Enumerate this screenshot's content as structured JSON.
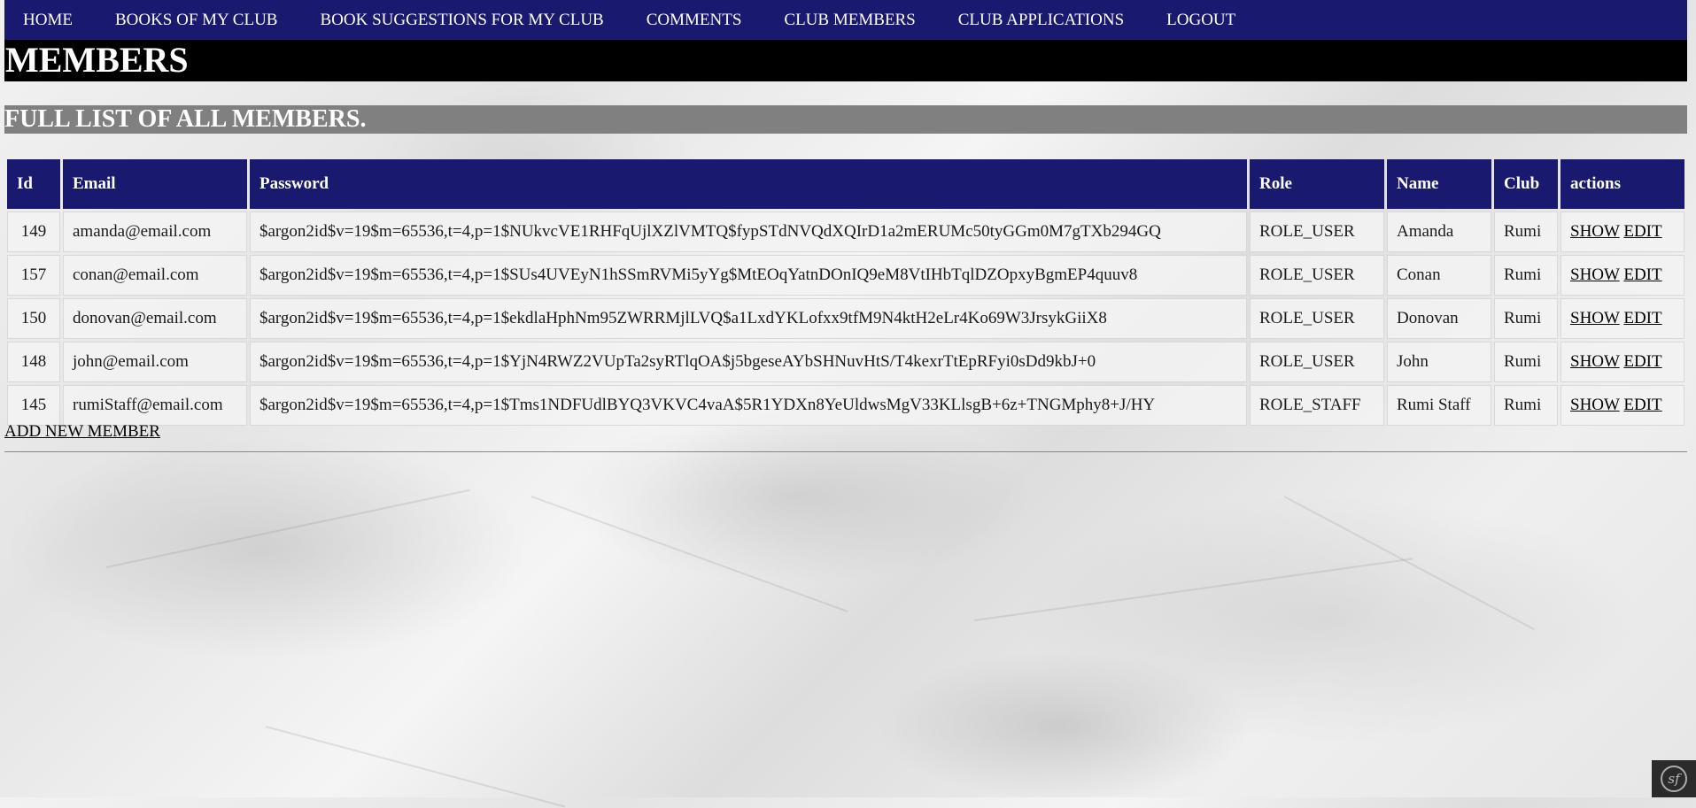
{
  "nav": {
    "items": [
      "HOME",
      "BOOKS OF MY CLUB",
      "BOOK SUGGESTIONS FOR MY CLUB",
      "COMMENTS",
      "CLUB MEMBERS",
      "CLUB APPLICATIONS",
      "LOGOUT"
    ]
  },
  "page": {
    "title": "MEMBERS",
    "subtitle": "FULL LIST OF ALL MEMBERS."
  },
  "table": {
    "headers": [
      "Id",
      "Email",
      "Password",
      "Role",
      "Name",
      "Club",
      "actions"
    ],
    "show_label": "SHOW",
    "edit_label": "EDIT",
    "rows": [
      {
        "id": "149",
        "email": "amanda@email.com",
        "password": "$argon2id$v=19$m=65536,t=4,p=1$NUkvcVE1RHFqUjlXZlVMTQ$fypSTdNVQdXQIrD1a2mERUMc50tyGGm0M7gTXb294GQ",
        "role": "ROLE_USER",
        "name": "Amanda",
        "club": "Rumi"
      },
      {
        "id": "157",
        "email": "conan@email.com",
        "password": "$argon2id$v=19$m=65536,t=4,p=1$SUs4UVEyN1hSSmRVMi5yYg$MtEOqYatnDOnIQ9eM8VtIHbTqlDZOpxyBgmEP4quuv8",
        "role": "ROLE_USER",
        "name": "Conan",
        "club": "Rumi"
      },
      {
        "id": "150",
        "email": "donovan@email.com",
        "password": "$argon2id$v=19$m=65536,t=4,p=1$ekdlaHphNm95ZWRRMjlLVQ$a1LxdYKLofxx9tfM9N4ktH2eLr4Ko69W3JrsykGiiX8",
        "role": "ROLE_USER",
        "name": "Donovan",
        "club": "Rumi"
      },
      {
        "id": "148",
        "email": "john@email.com",
        "password": "$argon2id$v=19$m=65536,t=4,p=1$YjN4RWZ2VUpTa2syRTlqOA$j5bgeseAYbSHNuvHtS/T4kexrTtEpRFyi0sDd9kbJ+0",
        "role": "ROLE_USER",
        "name": "John",
        "club": "Rumi"
      },
      {
        "id": "145",
        "email": "rumiStaff@email.com",
        "password": "$argon2id$v=19$m=65536,t=4,p=1$Tms1NDFUdlBYQ3VKVC4vaA$5R1YDXn8YeUldwsMgV33KLlsgB+6z+TNGMphy8+J/HY",
        "role": "ROLE_STAFF",
        "name": "Rumi Staff",
        "club": "Rumi"
      }
    ]
  },
  "add_member_label": "ADD NEW MEMBER",
  "toolbar_icon": "symfony-icon",
  "colors": {
    "nav_bg": "#191970",
    "title_bg": "#000000",
    "subtitle_bg": "#808080",
    "header_bg": "#191970"
  }
}
